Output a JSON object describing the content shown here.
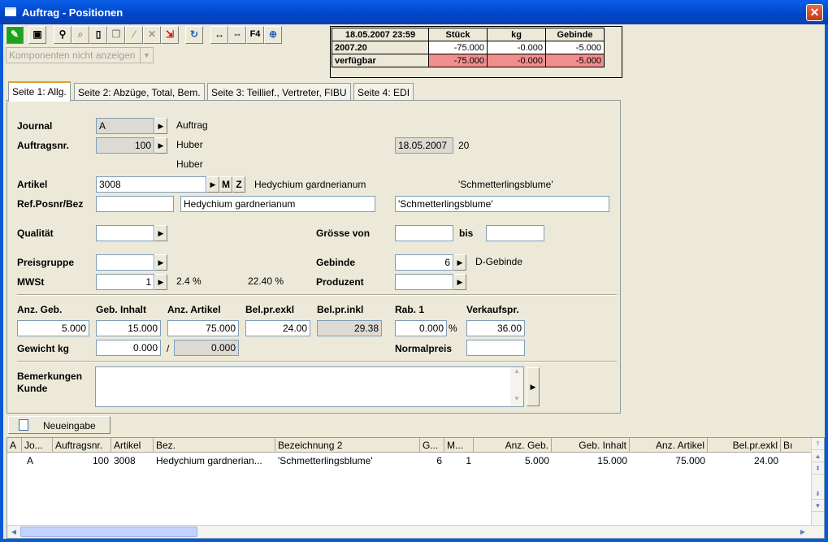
{
  "window": {
    "title": "Auftrag - Positionen",
    "close_glyph": "✕"
  },
  "toolbar": {
    "buttons": [
      "edit-icon",
      "save-icon",
      "find-icon",
      "search-icon",
      "new-document-icon",
      "copy-icon",
      "wand-icon",
      "delete-icon",
      "export-icon",
      "refresh-icon",
      "width-icon",
      "fit-icon",
      "f4-icon"
    ],
    "f4_label": "F4"
  },
  "components_combo": {
    "value": "Komponenten nicht anzeigen"
  },
  "summary": {
    "timestamp": "18.05.2007 23:59",
    "headers": [
      "Stück",
      "kg",
      "Gebinde"
    ],
    "rows": [
      {
        "label": "2007.20",
        "values": [
          "-75.000",
          "-0.000",
          "-5.000"
        ]
      },
      {
        "label": "verfügbar",
        "values": [
          "-75.000",
          "-0.000",
          "-5.000"
        ]
      }
    ],
    "alert_color": "#f08e8e"
  },
  "tabs": [
    {
      "label": "Seite 1: Allg."
    },
    {
      "label": "Seite 2: Abzüge, Total, Bem."
    },
    {
      "label": "Seite 3: Teillief., Vertreter, FIBU"
    },
    {
      "label": "Seite 4: EDI"
    }
  ],
  "form": {
    "journal": {
      "label": "Journal",
      "value": "A",
      "desc": "Auftrag"
    },
    "auftragsnr": {
      "label": "Auftragsnr.",
      "value": "100",
      "name1": "Huber",
      "name2": "Huber",
      "date": "18.05.2007",
      "week": "20"
    },
    "artikel": {
      "label": "Artikel",
      "value": "3008",
      "m": "M",
      "z": "Z",
      "name": "Hedychium gardnerianum",
      "common": "'Schmetterlingsblume'"
    },
    "refposnr": {
      "label": "Ref.Posnr/Bez",
      "value": "",
      "bez1": "Hedychium gardnerianum",
      "bez2": "'Schmetterlingsblume'"
    },
    "qualitaet": {
      "label": "Qualität",
      "value": ""
    },
    "groesse": {
      "label": "Grösse von",
      "von": "",
      "bis_label": "bis",
      "bis": ""
    },
    "preisgruppe": {
      "label": "Preisgruppe",
      "value": ""
    },
    "gebinde": {
      "label": "Gebinde",
      "value": "6",
      "desc": "D-Gebinde"
    },
    "mwst": {
      "label": "MWSt",
      "value": "1",
      "rate": "2.4 %",
      "pct": "22.40 %"
    },
    "produzent": {
      "label": "Produzent",
      "value": ""
    },
    "amounts": {
      "anz_geb": {
        "label": "Anz. Geb.",
        "value": "5.000"
      },
      "geb_inhalt": {
        "label": "Geb. Inhalt",
        "value": "15.000"
      },
      "anz_artikel": {
        "label": "Anz. Artikel",
        "value": "75.000"
      },
      "belpr_exkl": {
        "label": "Bel.pr.exkl",
        "value": "24.00"
      },
      "belpr_inkl": {
        "label": "Bel.pr.inkl",
        "value": "29.38"
      },
      "rab1": {
        "label": "Rab. 1",
        "value": "0.000",
        "unit": "%"
      },
      "verkaufspr": {
        "label": "Verkaufspr.",
        "value": "36.00"
      }
    },
    "gewicht": {
      "label": "Gewicht kg",
      "value": "0.000",
      "sep": "/",
      "value2": "0.000"
    },
    "normalpreis": {
      "label": "Normalpreis",
      "value": ""
    },
    "bemerkungen": {
      "label1": "Bemerkungen",
      "label2": "Kunde",
      "value": ""
    }
  },
  "neueingabe": {
    "label": "Neueingabe"
  },
  "grid": {
    "headers": [
      "A",
      "Jo...",
      "Auftragsnr.",
      "Artikel",
      "Bez.",
      "Bezeichnung 2",
      "G...",
      "M...",
      "Anz. Geb.",
      "Geb. Inhalt",
      "Anz. Artikel",
      "Bel.pr.exkl",
      "Bı"
    ],
    "rows": [
      [
        "",
        "A",
        "100",
        "3008",
        "Hedychium gardnerian...",
        "'Schmetterlingsblume'",
        "6",
        "1",
        "5.000",
        "15.000",
        "75.000",
        "24.00",
        ""
      ]
    ]
  }
}
